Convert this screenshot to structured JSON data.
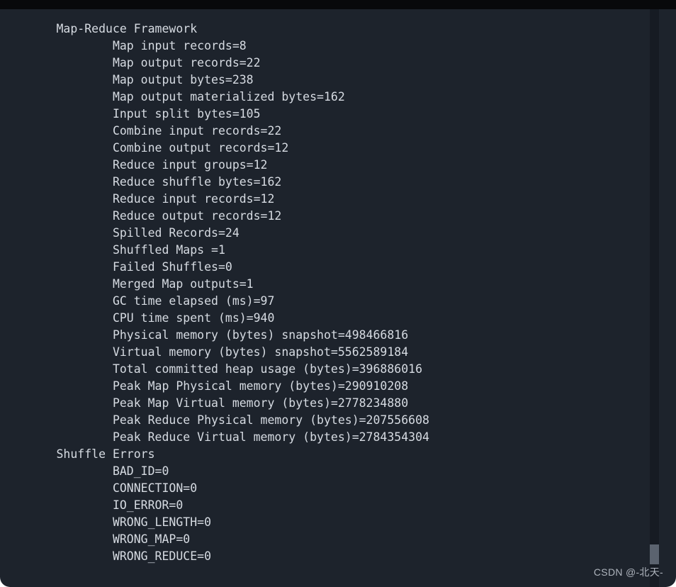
{
  "window": {
    "background_color": "#1d232c",
    "top_strip_color": "#08090b",
    "text_color": "#d6dbe2",
    "page_background": "#ffffff"
  },
  "scrollbar": {
    "track_color": "#161b23",
    "thumb_color": "#5b636f",
    "orientation": "vertical",
    "thumb_position": "near-bottom"
  },
  "console": {
    "indent_section": "        ",
    "indent_counter": "                ",
    "sections": [
      {
        "name": "Map-Reduce Framework",
        "counters": [
          {
            "label": "Map input records",
            "value": "8"
          },
          {
            "label": "Map output records",
            "value": "22"
          },
          {
            "label": "Map output bytes",
            "value": "238"
          },
          {
            "label": "Map output materialized bytes",
            "value": "162"
          },
          {
            "label": "Input split bytes",
            "value": "105"
          },
          {
            "label": "Combine input records",
            "value": "22"
          },
          {
            "label": "Combine output records",
            "value": "12"
          },
          {
            "label": "Reduce input groups",
            "value": "12"
          },
          {
            "label": "Reduce shuffle bytes",
            "value": "162"
          },
          {
            "label": "Reduce input records",
            "value": "12"
          },
          {
            "label": "Reduce output records",
            "value": "12"
          },
          {
            "label": "Spilled Records",
            "value": "24"
          },
          {
            "label": "Shuffled Maps ",
            "value": "1"
          },
          {
            "label": "Failed Shuffles",
            "value": "0"
          },
          {
            "label": "Merged Map outputs",
            "value": "1"
          },
          {
            "label": "GC time elapsed (ms)",
            "value": "97"
          },
          {
            "label": "CPU time spent (ms)",
            "value": "940"
          },
          {
            "label": "Physical memory (bytes) snapshot",
            "value": "498466816"
          },
          {
            "label": "Virtual memory (bytes) snapshot",
            "value": "5562589184"
          },
          {
            "label": "Total committed heap usage (bytes)",
            "value": "396886016"
          },
          {
            "label": "Peak Map Physical memory (bytes)",
            "value": "290910208"
          },
          {
            "label": "Peak Map Virtual memory (bytes)",
            "value": "2778234880"
          },
          {
            "label": "Peak Reduce Physical memory (bytes)",
            "value": "207556608"
          },
          {
            "label": "Peak Reduce Virtual memory (bytes)",
            "value": "2784354304"
          }
        ]
      },
      {
        "name": "Shuffle Errors",
        "counters": [
          {
            "label": "BAD_ID",
            "value": "0"
          },
          {
            "label": "CONNECTION",
            "value": "0"
          },
          {
            "label": "IO_ERROR",
            "value": "0"
          },
          {
            "label": "WRONG_LENGTH",
            "value": "0"
          },
          {
            "label": "WRONG_MAP",
            "value": "0"
          },
          {
            "label": "WRONG_REDUCE",
            "value": "0"
          }
        ]
      }
    ],
    "lines": [
      "        Map-Reduce Framework",
      "                Map input records=8",
      "                Map output records=22",
      "                Map output bytes=238",
      "                Map output materialized bytes=162",
      "                Input split bytes=105",
      "                Combine input records=22",
      "                Combine output records=12",
      "                Reduce input groups=12",
      "                Reduce shuffle bytes=162",
      "                Reduce input records=12",
      "                Reduce output records=12",
      "                Spilled Records=24",
      "                Shuffled Maps =1",
      "                Failed Shuffles=0",
      "                Merged Map outputs=1",
      "                GC time elapsed (ms)=97",
      "                CPU time spent (ms)=940",
      "                Physical memory (bytes) snapshot=498466816",
      "                Virtual memory (bytes) snapshot=5562589184",
      "                Total committed heap usage (bytes)=396886016",
      "                Peak Map Physical memory (bytes)=290910208",
      "                Peak Map Virtual memory (bytes)=2778234880",
      "                Peak Reduce Physical memory (bytes)=207556608",
      "                Peak Reduce Virtual memory (bytes)=2784354304",
      "        Shuffle Errors",
      "                BAD_ID=0",
      "                CONNECTION=0",
      "                IO_ERROR=0",
      "                WRONG_LENGTH=0",
      "                WRONG_MAP=0",
      "                WRONG_REDUCE=0"
    ]
  },
  "watermark": {
    "text": "CSDN @-北天-"
  }
}
